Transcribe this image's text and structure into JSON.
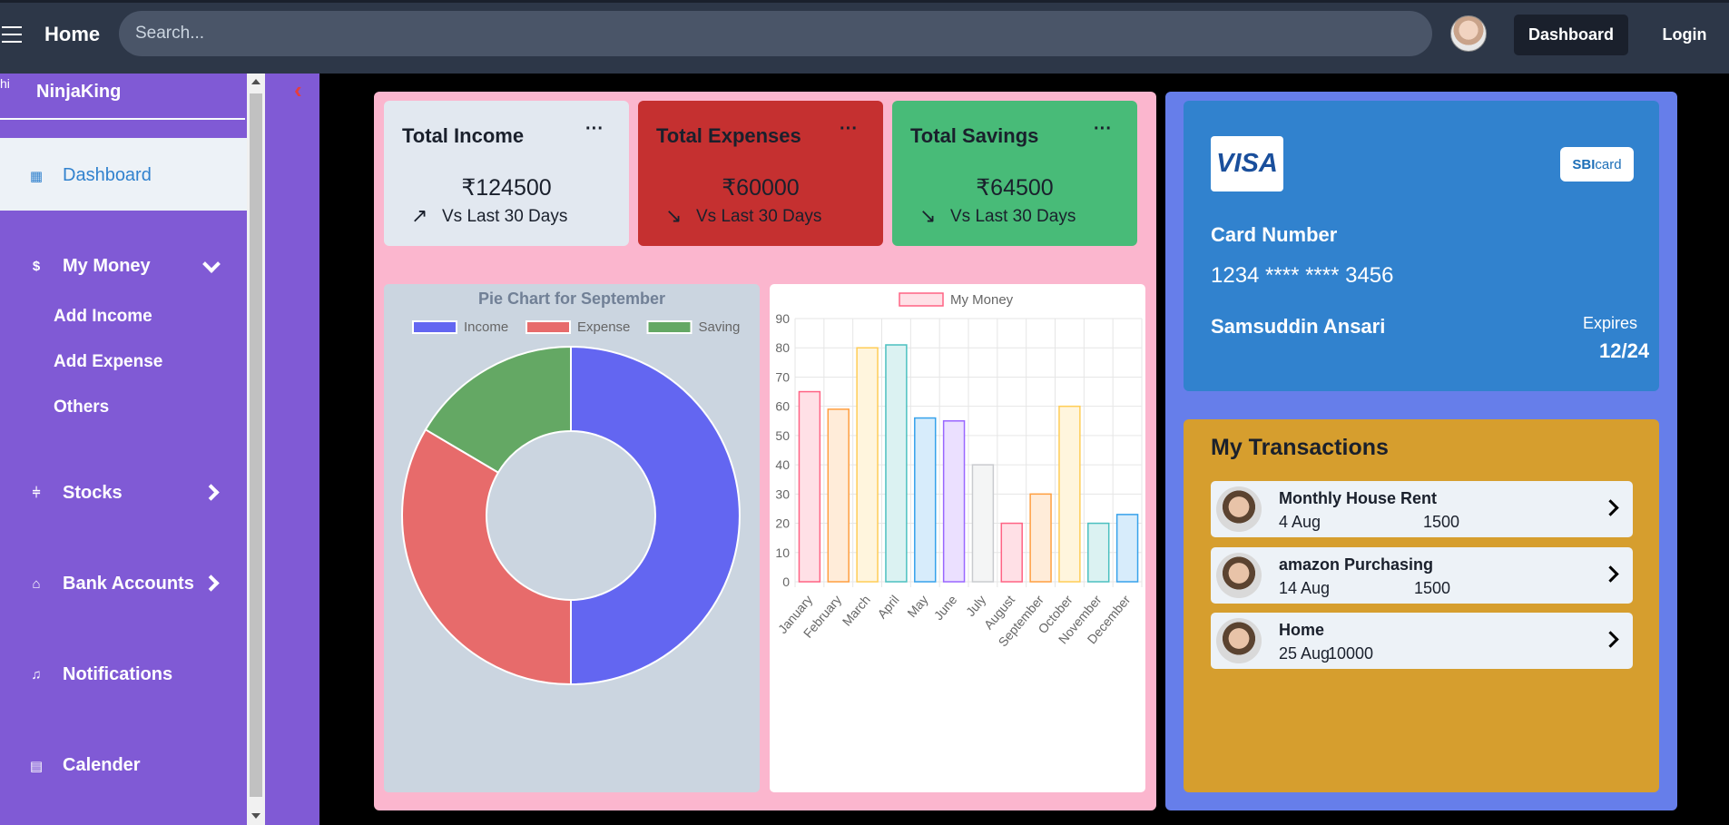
{
  "header": {
    "brand": "Home",
    "search_placeholder": "Search...",
    "dashboard_label": "Dashboard",
    "login_label": "Login"
  },
  "sidebar": {
    "logo_alt": "hi",
    "username": "NinjaKing",
    "items": [
      {
        "label": "Dashboard",
        "icon": "grid-icon"
      },
      {
        "label": "My Money",
        "icon": "dollar-icon"
      },
      {
        "label": "Stocks",
        "icon": "candlestick-icon"
      },
      {
        "label": "Bank Accounts",
        "icon": "bank-icon"
      },
      {
        "label": "Notifications",
        "icon": "bell-icon"
      },
      {
        "label": "Calender",
        "icon": "calendar-icon"
      }
    ],
    "money_subitems": [
      "Add Income",
      "Add Expense",
      "Others"
    ]
  },
  "stats": [
    {
      "title": "Total Income",
      "value": "₹124500",
      "compare": "Vs Last 30 Days",
      "trend": "up",
      "color": "#e2e8f0"
    },
    {
      "title": "Total Expenses",
      "value": "₹60000",
      "compare": "Vs Last 30 Days",
      "trend": "down",
      "color": "#c53030"
    },
    {
      "title": "Total Savings",
      "value": "₹64500",
      "compare": "Vs Last 30 Days",
      "trend": "down",
      "color": "#48bb78"
    }
  ],
  "stat_menu": "···",
  "chart_data": [
    {
      "type": "pie",
      "title": "Pie Chart for September",
      "categories": [
        "Income",
        "Expense",
        "Saving"
      ],
      "values": [
        50,
        33.5,
        16.5
      ],
      "colors": [
        "#6366f1",
        "#e76b6b",
        "#64a864"
      ],
      "legend": "top",
      "donut": true
    },
    {
      "type": "bar",
      "title": "",
      "categories": [
        "January",
        "February",
        "March",
        "April",
        "May",
        "June",
        "July",
        "August",
        "September",
        "October",
        "November",
        "December"
      ],
      "series": [
        {
          "name": "My Money",
          "values": [
            65,
            59,
            80,
            81,
            56,
            55,
            40,
            20,
            30,
            60,
            20,
            23
          ]
        }
      ],
      "ylim": [
        0,
        90
      ],
      "yticks": [
        0,
        10,
        20,
        30,
        40,
        50,
        60,
        70,
        80,
        90
      ],
      "grid": true,
      "legend": "top",
      "bar_fill": [
        "#ffe0e6",
        "#ffecd9",
        "#fff5dd",
        "#dbf2f2",
        "#d7ecfb",
        "#ebe0ff",
        "#f4f5f5",
        "#ffe0e6",
        "#ffecd9",
        "#fff5dd",
        "#dbf2f2",
        "#d7ecfb"
      ],
      "bar_stroke": [
        "#ff6384",
        "#ff9f40",
        "#ffcd56",
        "#4bc0c0",
        "#36a2eb",
        "#9966ff",
        "#c9cbcf",
        "#ff6384",
        "#ff9f40",
        "#ffcd56",
        "#4bc0c0",
        "#36a2eb"
      ]
    }
  ],
  "card": {
    "brand": "VISA",
    "issuer_prefix": "SBI",
    "issuer_suffix": "card",
    "number_label": "Card Number",
    "number": "1234 **** **** 3456",
    "holder": "Samsuddin Ansari",
    "expires_label": "Expires",
    "expires": "12/24"
  },
  "transactions": {
    "title": "My Transactions",
    "items": [
      {
        "name": "Monthly House Rent",
        "date": "4 Aug",
        "amount": "1500"
      },
      {
        "name": "amazon Purchasing",
        "date": "14 Aug",
        "amount": "1500"
      },
      {
        "name": "Home",
        "date": "25 Aug",
        "amount": "10000"
      }
    ]
  }
}
